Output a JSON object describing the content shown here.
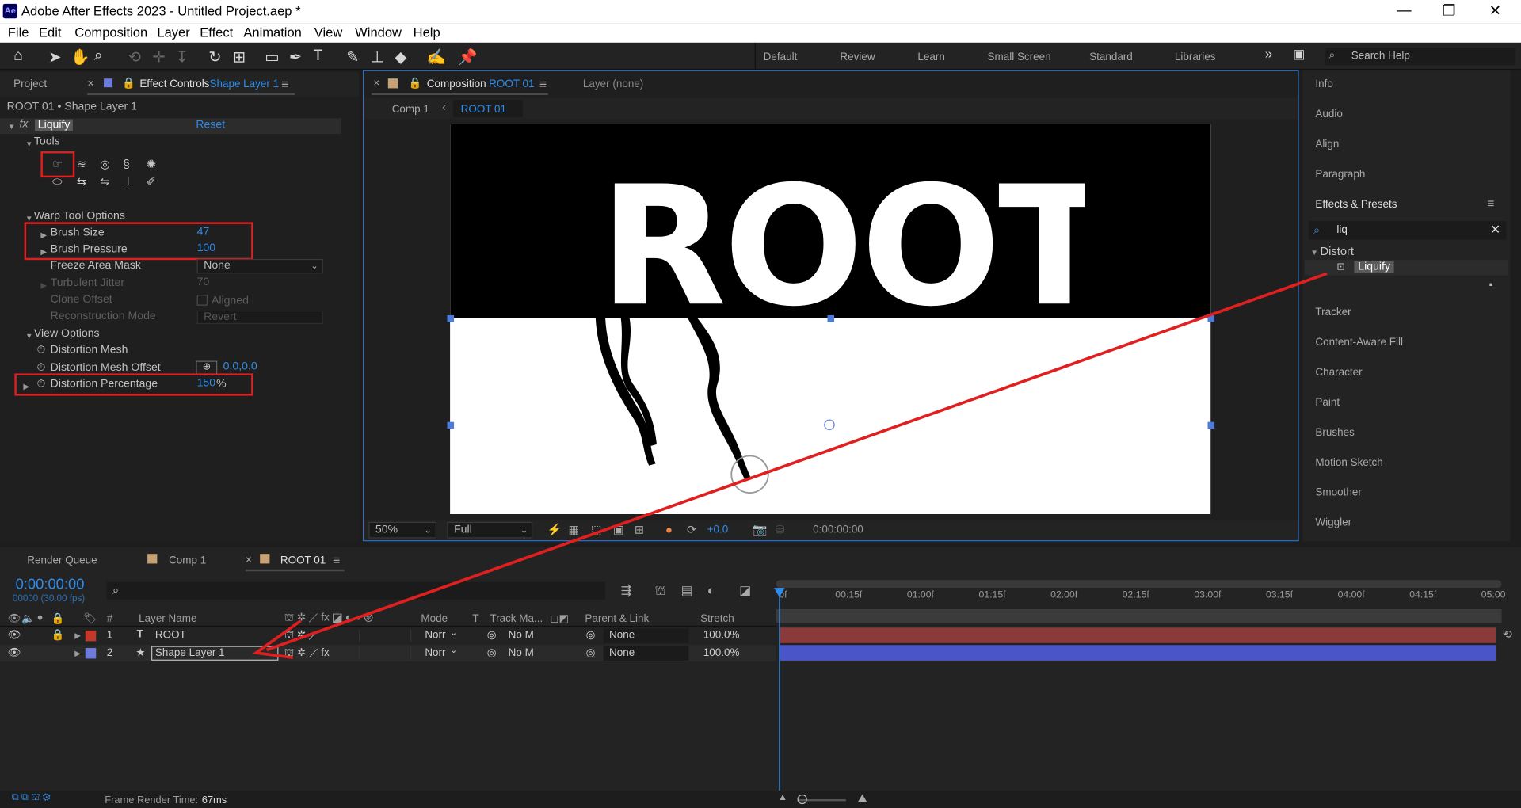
{
  "app": {
    "title": "Adobe After Effects 2023 - Untitled Project.aep *",
    "logo": "Ae"
  },
  "menu": [
    "File",
    "Edit",
    "Composition",
    "Layer",
    "Effect",
    "Animation",
    "View",
    "Window",
    "Help"
  ],
  "workspaces": [
    "Default",
    "Review",
    "Learn",
    "Small Screen",
    "Standard",
    "Libraries"
  ],
  "search_help": "Search Help",
  "left_panel": {
    "tab_project": "Project",
    "tab_effect_controls": "Effect Controls",
    "tab_effect_layer": "Shape Layer 1",
    "breadcrumb": "ROOT 01 • Shape Layer 1",
    "effect_name": "Liquify",
    "reset": "Reset",
    "tools_label": "Tools",
    "warp_label": "Warp Tool Options",
    "brush_size_label": "Brush Size",
    "brush_size": "47",
    "brush_pressure_label": "Brush Pressure",
    "brush_pressure": "100",
    "freeze_label": "Freeze Area Mask",
    "freeze_value": "None",
    "turbulent_label": "Turbulent Jitter",
    "turbulent_value": "70",
    "clone_label": "Clone Offset",
    "aligned_label": "Aligned",
    "recon_label": "Reconstruction Mode",
    "recon_value": "Revert",
    "view_options_label": "View Options",
    "mesh_label": "Distortion Mesh",
    "mesh_offset_label": "Distortion Mesh Offset",
    "mesh_offset": "0.0,0.0",
    "pct_label": "Distortion Percentage",
    "pct_value": "150",
    "pct_unit": "%"
  },
  "comp_panel": {
    "tab_composition": "Composition",
    "tab_comp_name": "ROOT 01",
    "layer_tab": "Layer (none)",
    "crumb_comp1": "Comp 1",
    "crumb_root": "ROOT 01",
    "canvas_text": "ROOT",
    "zoom": "50%",
    "resolution": "Full",
    "exposure": "+0.0",
    "timecode": "0:00:00:00"
  },
  "right_panel": {
    "items_top": [
      "Info",
      "Audio",
      "Align",
      "Paragraph"
    ],
    "effects_presets": "Effects & Presets",
    "search_value": "liq",
    "category": "Distort",
    "result": "Liquify",
    "items_bottom": [
      "Tracker",
      "Content-Aware Fill",
      "Character",
      "Paint",
      "Brushes",
      "Motion Sketch",
      "Smoother",
      "Wiggler"
    ]
  },
  "timeline": {
    "tab_render": "Render Queue",
    "tab_comp1": "Comp 1",
    "tab_root": "ROOT 01",
    "timecode": "0:00:00:00",
    "fps": "00000 (30.00 fps)",
    "ruler": [
      "0f",
      "00:15f",
      "01:00f",
      "01:15f",
      "02:00f",
      "02:15f",
      "03:00f",
      "03:15f",
      "04:00f",
      "04:15f",
      "05:00"
    ],
    "headers": {
      "hash": "#",
      "layer_name": "Layer Name",
      "mode": "Mode",
      "t": "T",
      "track": "Track Ma...",
      "parent": "Parent & Link",
      "stretch": "Stretch"
    },
    "layers": [
      {
        "num": "1",
        "type": "T",
        "name": "ROOT",
        "mode": "Norr",
        "track": "No M",
        "parent": "None",
        "stretch": "100.0%",
        "color": "#c0392b"
      },
      {
        "num": "2",
        "type": "★",
        "name": "Shape Layer 1",
        "mode": "Norr",
        "track": "No M",
        "parent": "None",
        "stretch": "100.0%",
        "color": "#6d7bdc"
      }
    ],
    "render_time_label": "Frame Render Time:",
    "render_time": "67ms"
  },
  "colors": {
    "accent": "#2d8ceb",
    "annotation": "#e02020",
    "layer1_bar": "#8b3a3a",
    "layer2_bar": "#4a55c8"
  }
}
